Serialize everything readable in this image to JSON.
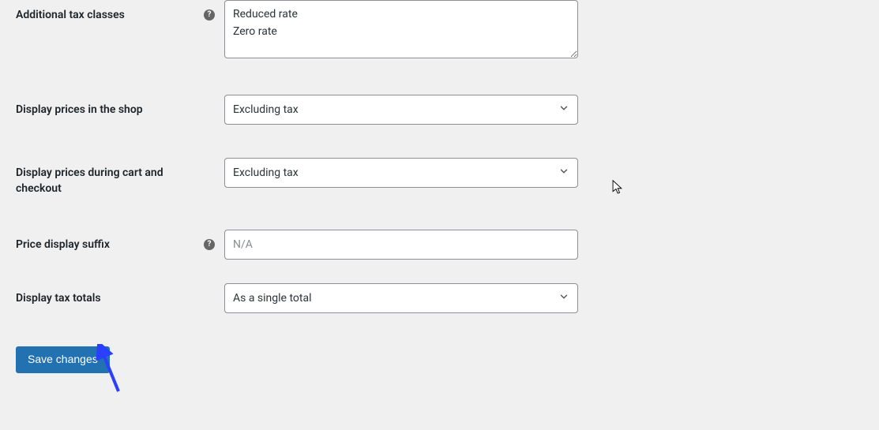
{
  "fields": {
    "additional_tax_classes": {
      "label": "Additional tax classes",
      "value": "Reduced rate\nZero rate"
    },
    "display_prices_shop": {
      "label": "Display prices in the shop",
      "value": "Excluding tax"
    },
    "display_prices_cart": {
      "label": "Display prices during cart and checkout",
      "value": "Excluding tax"
    },
    "price_display_suffix": {
      "label": "Price display suffix",
      "placeholder": "N/A",
      "value": ""
    },
    "display_tax_totals": {
      "label": "Display tax totals",
      "value": "As a single total"
    }
  },
  "buttons": {
    "save": "Save changes"
  }
}
